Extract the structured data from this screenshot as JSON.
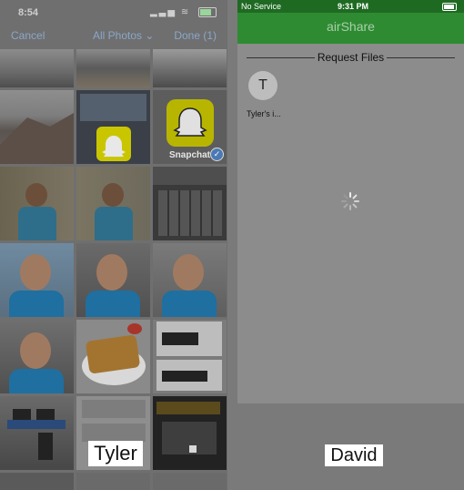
{
  "left_screen": {
    "status_time": "8:54",
    "status_icons": "▂▃▅ ≋",
    "cancel_label": "Cancel",
    "album_label": "All Photos",
    "album_chevron": "⌄",
    "done_label": "Done (1)",
    "snapchat_caption": "Snapchat",
    "caption_label": "Tyler",
    "selected_count": 1
  },
  "right_screen": {
    "carrier": "No Service",
    "clock": "9:31 PM",
    "app_title": "airShare",
    "section_title": "Request Files",
    "avatar_initial": "T",
    "avatar_name": "Tyler's i...",
    "caption_label": "David"
  },
  "colors": {
    "app_green": "#2e8b32",
    "snapchat_yellow": "#fffc00",
    "ios_blue": "#8aa7c8"
  }
}
